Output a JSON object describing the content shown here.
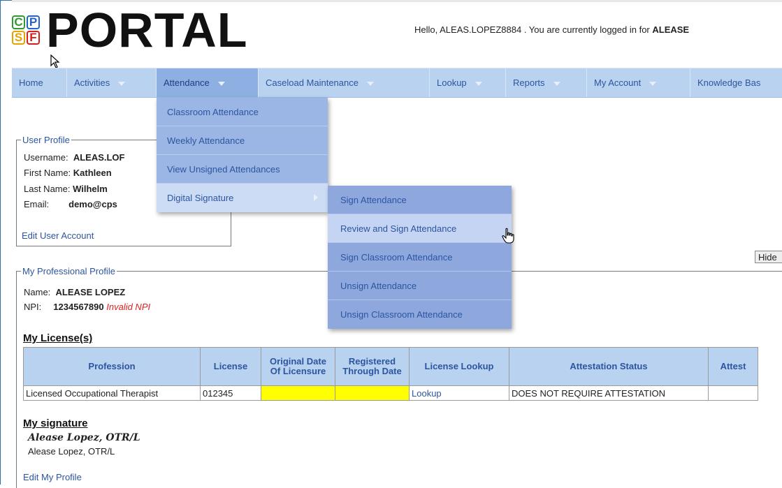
{
  "logo": {
    "tiles": [
      "C",
      "P",
      "S",
      "F"
    ],
    "word": "PORTAL"
  },
  "greeting": {
    "text": "Hello, ALEAS.LOPEZ8884 . You are currently logged in for ",
    "bold": "ALEASE"
  },
  "nav": [
    {
      "label": "Home",
      "caret": false
    },
    {
      "label": "Activities",
      "caret": true
    },
    {
      "label": "Attendance",
      "caret": true
    },
    {
      "label": "Caseload Maintenance",
      "caret": true
    },
    {
      "label": "Lookup",
      "caret": true
    },
    {
      "label": "Reports",
      "caret": true
    },
    {
      "label": "My Account",
      "caret": true
    },
    {
      "label": "Knowledge Bas",
      "caret": false
    }
  ],
  "attendance_menu": [
    "Classroom Attendance",
    "Weekly Attendance",
    "View Unsigned Attendances",
    "Digital Signature"
  ],
  "signature_submenu": [
    "Sign Attendance",
    "Review and Sign Attendance",
    "Sign Classroom Attendance",
    "Unsign Attendance",
    "Unsign Classroom Attendance"
  ],
  "user_profile": {
    "legend": "User Profile",
    "username_label": "Username:",
    "username": "ALEAS.LOF",
    "first_label": "First Name:",
    "first": "Kathleen",
    "last_label": "Last Name:",
    "last": "Wilhelm",
    "email_label": "Email:",
    "email": "demo@cps",
    "edit_link": "Edit User Account"
  },
  "hide_button": "Hide",
  "professional_profile": {
    "legend": "My Professional Profile",
    "name_label": "Name:",
    "name": "ALEASE LOPEZ",
    "npi_label": "NPI:",
    "npi": "1234567890",
    "npi_status": "Invalid NPI"
  },
  "licenses": {
    "heading": "My License(s)",
    "columns": [
      "Profession",
      "License",
      "Original Date Of Licensure",
      "Registered Through Date",
      "License Lookup",
      "Attestation Status",
      "Attest"
    ],
    "rows": [
      [
        "Licensed Occupational Therapist",
        "012345",
        "",
        "",
        "Lookup",
        "DOES NOT REQUIRE ATTESTATION",
        ""
      ]
    ],
    "highlight_color": "#ffff00"
  },
  "signature": {
    "heading": "My signature",
    "script": "Alease Lopez, OTR/L",
    "printed": "Alease Lopez, OTR/L"
  },
  "edit_profile_link": "Edit My Profile",
  "colors": {
    "nav_bg": "#b9d2ef",
    "link": "#2c55a0",
    "invalid": "#e02020"
  }
}
